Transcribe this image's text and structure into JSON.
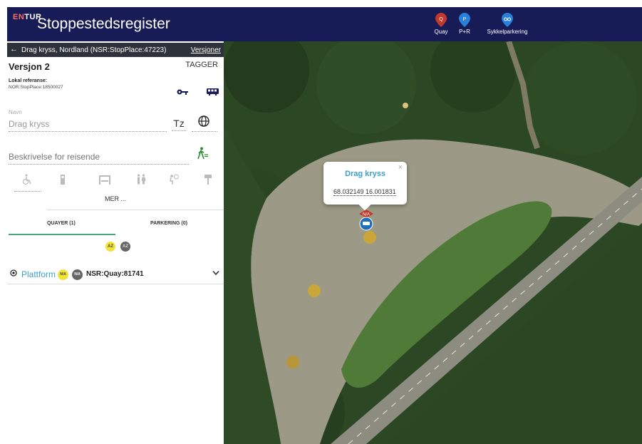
{
  "header": {
    "brand": {
      "en": "EN",
      "tur": "TUR"
    },
    "title": "Stoppestedsregister",
    "buttons": [
      {
        "label": "Quay",
        "icon": "quay-pin-icon",
        "color": "#c0392b"
      },
      {
        "label": "P+R",
        "icon": "parking-pin-icon",
        "color": "#2980d9"
      },
      {
        "label": "Sykkelparkering",
        "icon": "bike-parking-pin-icon",
        "color": "#2980d9"
      }
    ],
    "background": "#181c56"
  },
  "panel": {
    "breadcrumb": "Drag kryss, Nordland (NSR:StopPlace:47223)",
    "versions_label": "Versjoner",
    "version_title": "Versjon 2",
    "tags_label": "TAGGER",
    "local_ref_label": "Lokal referanse:",
    "local_ref_value": "NOR:StopPlace:18500027",
    "name_label": "Navn",
    "name_value": "Drag kryss",
    "tz_label": "Tz",
    "description_placeholder": "Beskrivelse for reisende",
    "facilities": [
      "wheelchair-icon",
      "ticket-machine-icon",
      "shelter-icon",
      "wc-icon",
      "help-icon",
      "sign-icon"
    ],
    "more_label": "MER ...",
    "tabs": [
      {
        "label": "QUAYER (1)",
        "active": true
      },
      {
        "label": "PARKERING (0)",
        "active": false
      }
    ],
    "sort_labels": [
      "AZ",
      "AZ"
    ],
    "quay": {
      "name": "Plattform",
      "badge1": "N/A",
      "badge2": "N/A",
      "id": "NSR:Quay:81741"
    }
  },
  "map": {
    "popup": {
      "title": "Drag kryss",
      "coords": "68.032149 16.001831",
      "close": "×"
    },
    "marker_label": "N/A",
    "accent": "#3a9ecf"
  }
}
